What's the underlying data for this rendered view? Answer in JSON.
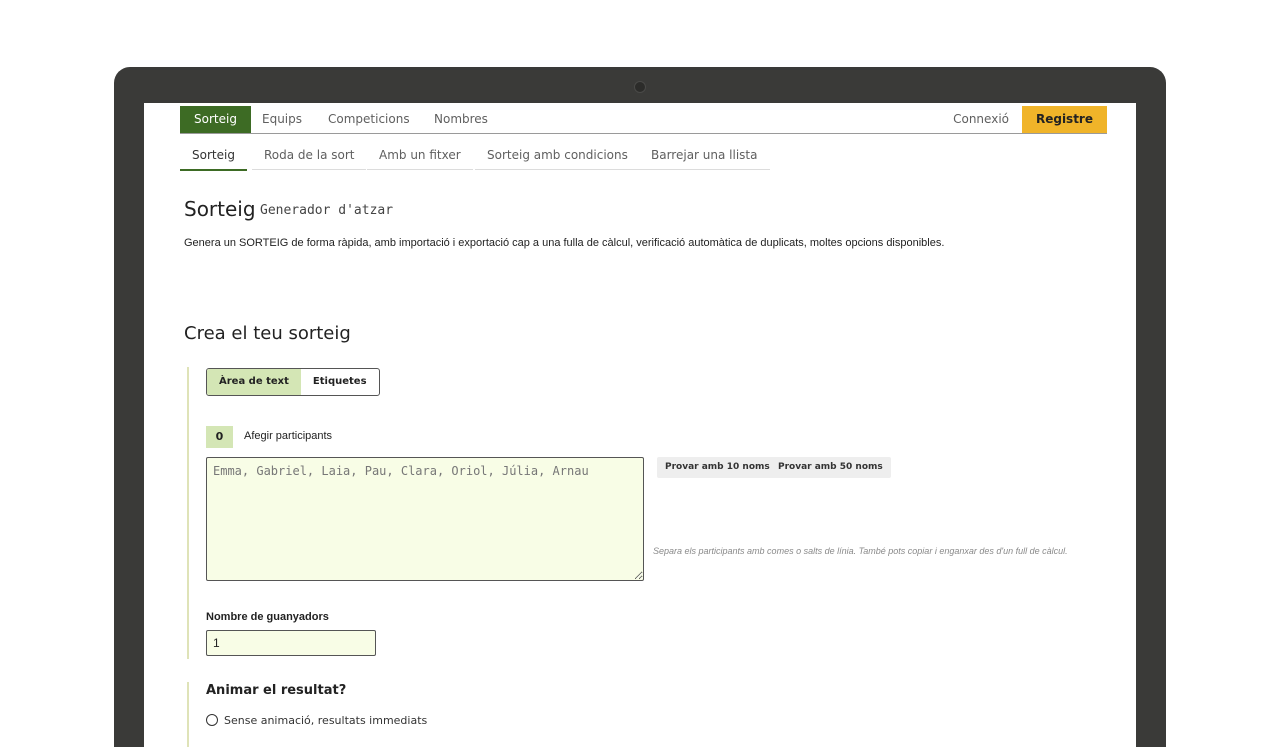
{
  "topnav": {
    "tabs": [
      {
        "label": "Sorteig",
        "active": true
      },
      {
        "label": "Equips",
        "active": false
      },
      {
        "label": "Competicions",
        "active": false
      },
      {
        "label": "Nombres",
        "active": false
      }
    ],
    "login": "Connexió",
    "register": "Registre"
  },
  "subnav": {
    "items": [
      {
        "label": "Sorteig",
        "active": true
      },
      {
        "label": "Roda de la sort",
        "active": false
      },
      {
        "label": "Amb un fitxer",
        "active": false
      },
      {
        "label": "Sorteig amb condicions",
        "active": false
      },
      {
        "label": "Barrejar una llista",
        "active": false
      }
    ]
  },
  "header": {
    "title": "Sorteig",
    "subtitle": "Generador d'atzar",
    "description": "Genera un SORTEIG de forma ràpida, amb importació i exportació cap a una fulla de càlcul, verificació automàtica de duplicats, moltes opcions disponibles."
  },
  "form": {
    "section_title": "Crea el teu sorteig",
    "mode_toggle": {
      "text_area": "Àrea de text",
      "tags": "Etiquetes"
    },
    "participant_count": "0",
    "participants_label": "Afegir participants",
    "participants_placeholder": "Emma, Gabriel, Laia, Pau, Clara, Oriol, Júlia, Arnau",
    "try_10": "Provar amb 10 noms",
    "try_50": "Provar amb 50 noms",
    "hint": "Separa els participants amb comes o salts de línia. També pots copiar i enganxar des d'un full de càlcul.",
    "winners_label": "Nombre de guanyadors",
    "winners_value": "1",
    "animate_title": "Animar el resultat?",
    "animate_option_1": "Sense animació, resultats immediats"
  },
  "colors": {
    "accent": "#3d6b24",
    "register": "#f0b429",
    "input_bg": "#f8fde6",
    "badge_bg": "#d4e6b5"
  }
}
